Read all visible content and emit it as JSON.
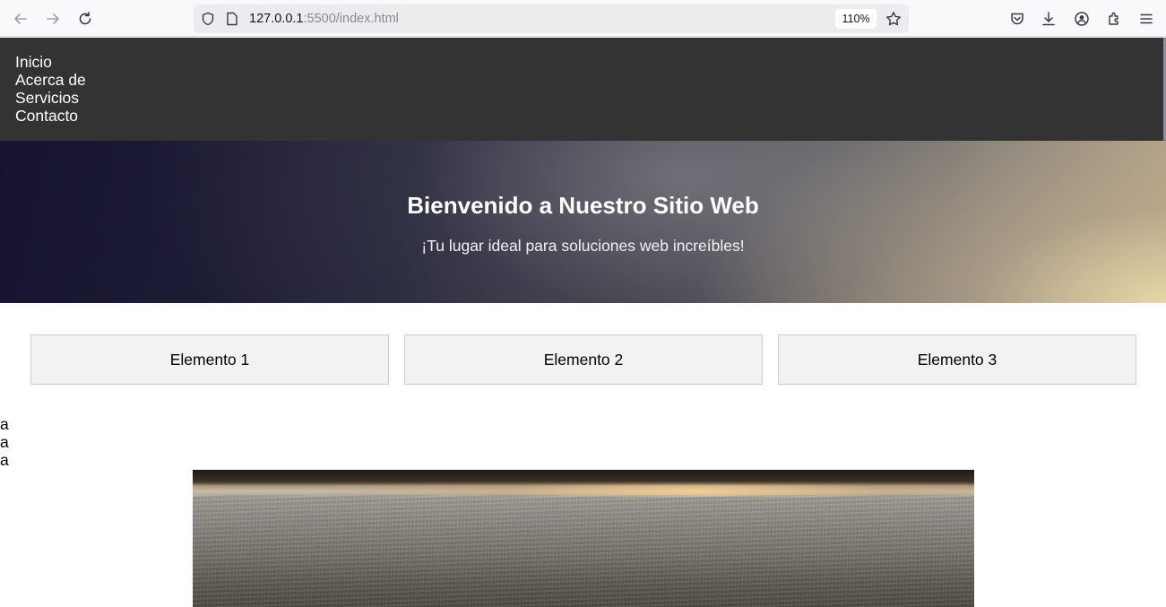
{
  "browser": {
    "url_host": "127.0.0.1",
    "url_path": ":5500/index.html",
    "zoom": "110%",
    "icons": [
      "back-arrow-icon",
      "forward-arrow-icon",
      "reload-icon",
      "shield-icon",
      "page-icon",
      "star-icon",
      "pocket-icon",
      "download-icon",
      "account-icon",
      "extensions-icon",
      "menu-icon"
    ]
  },
  "nav": {
    "items": [
      {
        "label": "Inicio"
      },
      {
        "label": "Acerca de"
      },
      {
        "label": "Servicios"
      },
      {
        "label": "Contacto"
      }
    ]
  },
  "hero": {
    "title": "Bienvenido a Nuestro Sitio Web",
    "subtitle": "¡Tu lugar ideal para soluciones web increíbles!"
  },
  "cards": [
    {
      "label": "Elemento 1"
    },
    {
      "label": "Elemento 2"
    },
    {
      "label": "Elemento 3"
    }
  ],
  "lines": [
    "a",
    "a",
    "a"
  ],
  "colors": {
    "nav_bg": "#333333",
    "card_bg": "#f2f2f2",
    "card_border": "#cccccc"
  }
}
